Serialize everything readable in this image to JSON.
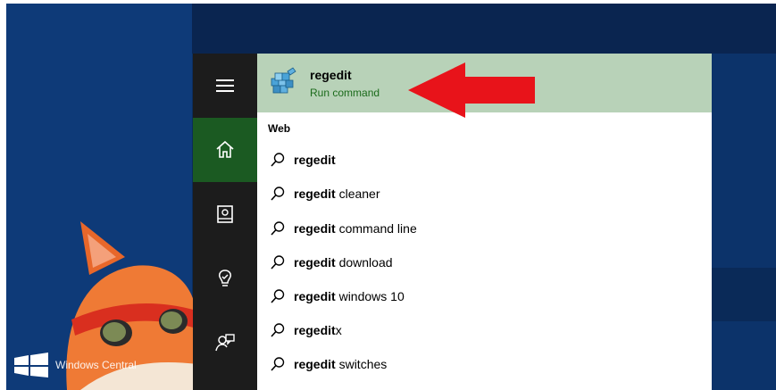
{
  "best_match": {
    "title": "regedit",
    "subtitle": "Run command",
    "icon": "registry-editor-icon"
  },
  "section_header": "Web",
  "suggestions": [
    {
      "bold": "regedit",
      "rest": ""
    },
    {
      "bold": "regedit",
      "rest": " cleaner"
    },
    {
      "bold": "regedit",
      "rest": " command line"
    },
    {
      "bold": "regedit",
      "rest": " download"
    },
    {
      "bold": "regedit",
      "rest": " windows 10"
    },
    {
      "bold": "regedit",
      "rest": "x"
    },
    {
      "bold": "regedit",
      "rest": " switches"
    }
  ],
  "rail": {
    "items": [
      "hamburger-menu-icon",
      "home-icon",
      "notebook-icon",
      "reminders-icon",
      "feedback-icon"
    ]
  },
  "watermark": {
    "text": "Windows Central"
  },
  "colors": {
    "accent": "#1b5a22",
    "highlight": "#b8d2b8",
    "arrow": "#e8131a"
  }
}
